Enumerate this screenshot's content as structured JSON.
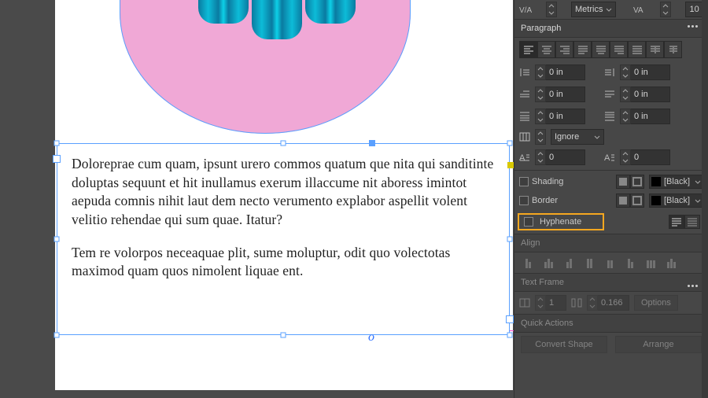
{
  "canvas": {
    "paragraph1": "Doloreprae cum quam, ipsunt urero commos quatum que nita qui sanditinte doluptas sequunt et hit inullamus exerum illaccume nit aboress imintot aepuda comnis nihit laut dem necto verumento explabor aspellit volent velitio rehendae qui sum quae. Itatur?",
    "paragraph2": "Tem re volorpos neceaquae plit, sume moluptur, odit quo volectotas maximod quam quos nimolent liquae ent.",
    "overset_glyph": "o"
  },
  "character_row": {
    "kerning_label": "Metrics",
    "tracking_value": "10"
  },
  "panel_paragraph": {
    "title": "Paragraph",
    "indents": {
      "left": "0 in",
      "right": "0 in",
      "first_line": "0 in",
      "last_line": "0 in",
      "space_before": "0 in",
      "space_after": "0 in"
    },
    "ignore_label": "Ignore",
    "dropcap_lines": "0",
    "dropcap_chars": "0",
    "shading_label": "Shading",
    "border_label": "Border",
    "swatch_black": "[Black]",
    "hyphenate_label": "Hyphenate"
  },
  "panel_align": {
    "title": "Align"
  },
  "panel_textframe": {
    "title": "Text Frame",
    "cols": "1",
    "gutter": "0.166",
    "options_label": "Options"
  },
  "panel_quick": {
    "title": "Quick Actions",
    "convert": "Convert Shape",
    "arrange": "Arrange"
  }
}
